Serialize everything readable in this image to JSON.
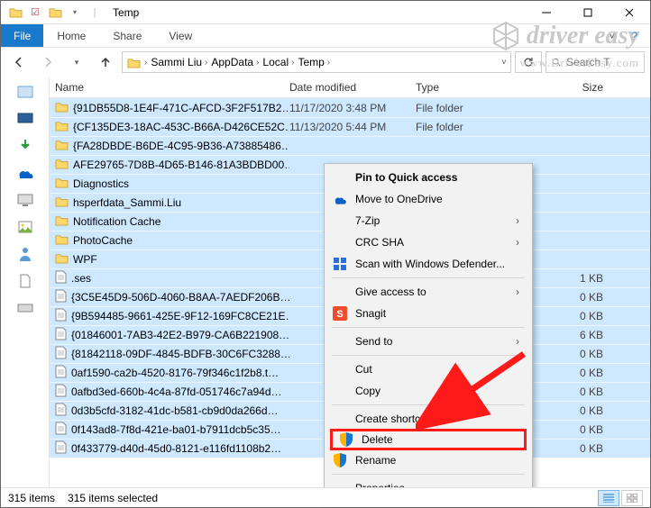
{
  "titlebar": {
    "title": "Temp"
  },
  "ribbon": {
    "file": "File",
    "tabs": [
      "Home",
      "Share",
      "View"
    ]
  },
  "breadcrumb": [
    "Sammi Liu",
    "AppData",
    "Local",
    "Temp"
  ],
  "search": {
    "placeholder": "Search T"
  },
  "columns": {
    "name": "Name",
    "date": "Date modified",
    "type": "Type",
    "size": "Size"
  },
  "rows": [
    {
      "icon": "folder",
      "name": "{91DB55D8-1E4F-471C-AFCD-3F2F517B2…",
      "date": "11/17/2020 3:48 PM",
      "type": "File folder",
      "size": ""
    },
    {
      "icon": "folder",
      "name": "{CF135DE3-18AC-453C-B66A-D426CE52C…",
      "date": "11/13/2020 5:44 PM",
      "type": "File folder",
      "size": ""
    },
    {
      "icon": "folder",
      "name": "{FA28DBDE-B6DE-4C95-9B36-A73885486…",
      "date": "",
      "type": "",
      "size": ""
    },
    {
      "icon": "folder",
      "name": "AFE29765-7D8B-4D65-B146-81A3BDBD00…",
      "date": "",
      "type": "",
      "size": ""
    },
    {
      "icon": "folder",
      "name": "Diagnostics",
      "date": "",
      "type": "",
      "size": ""
    },
    {
      "icon": "folder",
      "name": "hsperfdata_Sammi.Liu",
      "date": "",
      "type": "",
      "size": ""
    },
    {
      "icon": "folder",
      "name": "Notification Cache",
      "date": "",
      "type": "",
      "size": ""
    },
    {
      "icon": "folder",
      "name": "PhotoCache",
      "date": "",
      "type": "",
      "size": ""
    },
    {
      "icon": "folder",
      "name": "WPF",
      "date": "",
      "type": "",
      "size": ""
    },
    {
      "icon": "file",
      "name": ".ses",
      "date": "",
      "type": "",
      "size": "1 KB"
    },
    {
      "icon": "file",
      "name": "{3C5E45D9-506D-4060-B8AA-7AEDF206B…",
      "date": "",
      "type": "",
      "size": "0 KB"
    },
    {
      "icon": "file",
      "name": "{9B594485-9661-425E-9F12-169FC8CE21E…",
      "date": "",
      "type": "",
      "size": "0 KB"
    },
    {
      "icon": "file",
      "name": "{01846001-7AB3-42E2-B979-CA6B221908…",
      "date": "",
      "type": "",
      "size": "6 KB"
    },
    {
      "icon": "file",
      "name": "{81842118-09DF-4845-BDFB-30C6FC3288…",
      "date": "",
      "type": "",
      "size": "0 KB"
    },
    {
      "icon": "file",
      "name": "0af1590-ca2b-4520-8176-79f346c1f2b8.t…",
      "date": "",
      "type": "",
      "size": "0 KB"
    },
    {
      "icon": "file",
      "name": "0afbd3ed-660b-4c4a-87fd-051746c7a94d…",
      "date": "",
      "type": "",
      "size": "0 KB"
    },
    {
      "icon": "file",
      "name": "0d3b5cfd-3182-41dc-b581-cb9d0da266d…",
      "date": "",
      "type": "",
      "size": "0 KB"
    },
    {
      "icon": "file",
      "name": "0f143ad8-7f8d-421e-ba01-b7911dcb5c35…",
      "date": "",
      "type": "",
      "size": "0 KB"
    },
    {
      "icon": "file",
      "name": "0f433779-d40d-45d0-8121-e116fd1108b2…",
      "date": "",
      "type": "",
      "size": "0 KB"
    }
  ],
  "context_menu": [
    {
      "type": "item",
      "label": "Pin to Quick access",
      "bold": true
    },
    {
      "type": "item",
      "label": "Move to OneDrive",
      "icon": "cloud"
    },
    {
      "type": "item",
      "label": "7-Zip",
      "submenu": true
    },
    {
      "type": "item",
      "label": "CRC SHA",
      "submenu": true
    },
    {
      "type": "item",
      "label": "Scan with Windows Defender...",
      "icon": "defender"
    },
    {
      "type": "sep"
    },
    {
      "type": "item",
      "label": "Give access to",
      "submenu": true
    },
    {
      "type": "item",
      "label": "Snagit",
      "icon": "snagit"
    },
    {
      "type": "sep"
    },
    {
      "type": "item",
      "label": "Send to",
      "submenu": true
    },
    {
      "type": "sep"
    },
    {
      "type": "item",
      "label": "Cut"
    },
    {
      "type": "item",
      "label": "Copy"
    },
    {
      "type": "sep"
    },
    {
      "type": "item",
      "label": "Create shortcut"
    },
    {
      "type": "item",
      "label": "Delete",
      "icon": "shield",
      "highlight": true
    },
    {
      "type": "item",
      "label": "Rename",
      "icon": "shield"
    },
    {
      "type": "sep"
    },
    {
      "type": "item",
      "label": "Properties"
    }
  ],
  "status": {
    "items_total": "315 items",
    "items_selected": "315 items selected"
  },
  "watermark": {
    "brand": "driver easy",
    "url": "www.DriverEasy.com"
  }
}
